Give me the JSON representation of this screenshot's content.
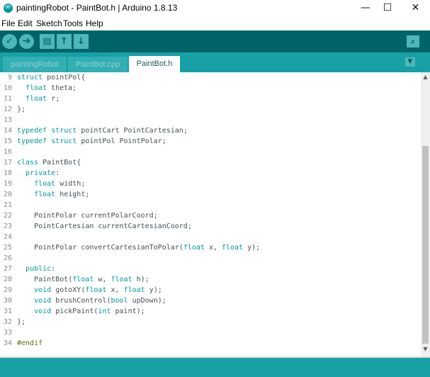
{
  "window": {
    "title": "paintingRobot - PaintBot.h | Arduino 1.8.13",
    "minimize": "—",
    "maximize": "☐",
    "close": "✕"
  },
  "menu": [
    "File",
    "Edit",
    "Sketch",
    "Tools",
    "Help"
  ],
  "toolbar": {
    "verify_icon": "✓",
    "upload_icon": "➔",
    "new_icon": "▤",
    "open_icon": "↑",
    "save_icon": "↓",
    "serial_icon": "⌕"
  },
  "tabs": [
    {
      "label": "paintingRobot",
      "active": false
    },
    {
      "label": "PaintBot.cpp",
      "active": false
    },
    {
      "label": "PaintBot.h",
      "active": true
    }
  ],
  "tab_menu_icon": "▼",
  "editor": {
    "lines": [
      {
        "n": "9",
        "code": "struct pointPol{"
      },
      {
        "n": "10",
        "code": "  float theta;"
      },
      {
        "n": "11",
        "code": "  float r;"
      },
      {
        "n": "12",
        "code": "};"
      },
      {
        "n": "13",
        "code": ""
      },
      {
        "n": "14",
        "code": "typedef struct pointCart PointCartesian;"
      },
      {
        "n": "15",
        "code": "typedef struct pointPol PointPolar;"
      },
      {
        "n": "16",
        "code": ""
      },
      {
        "n": "17",
        "code": "class PaintBot{"
      },
      {
        "n": "18",
        "code": "  private:"
      },
      {
        "n": "19",
        "code": "    float width;"
      },
      {
        "n": "20",
        "code": "    float height;"
      },
      {
        "n": "21",
        "code": ""
      },
      {
        "n": "22",
        "code": "    PointPolar currentPolarCoord;"
      },
      {
        "n": "23",
        "code": "    PointCartesian currentCartesianCoord;"
      },
      {
        "n": "24",
        "code": ""
      },
      {
        "n": "25",
        "code": "    PointPolar convertCartesianToPolar(float x, float y);"
      },
      {
        "n": "26",
        "code": ""
      },
      {
        "n": "27",
        "code": "  public:"
      },
      {
        "n": "28",
        "code": "    PaintBot(float w, float h);"
      },
      {
        "n": "29",
        "code": "    void gotoXY(float x, float y);"
      },
      {
        "n": "30",
        "code": "    void brushControl(bool upDown);"
      },
      {
        "n": "31",
        "code": "    void pickPaint(int paint);"
      },
      {
        "n": "32",
        "code": "};"
      },
      {
        "n": "33",
        "code": ""
      },
      {
        "n": "34",
        "code": "#endif"
      }
    ]
  },
  "scrollbar": {
    "up": "▲",
    "down": "▼"
  },
  "colors": {
    "toolbar": "#006468",
    "tabbar": "#17a1a5",
    "keyword": "#00979c",
    "type": "#00979c"
  }
}
